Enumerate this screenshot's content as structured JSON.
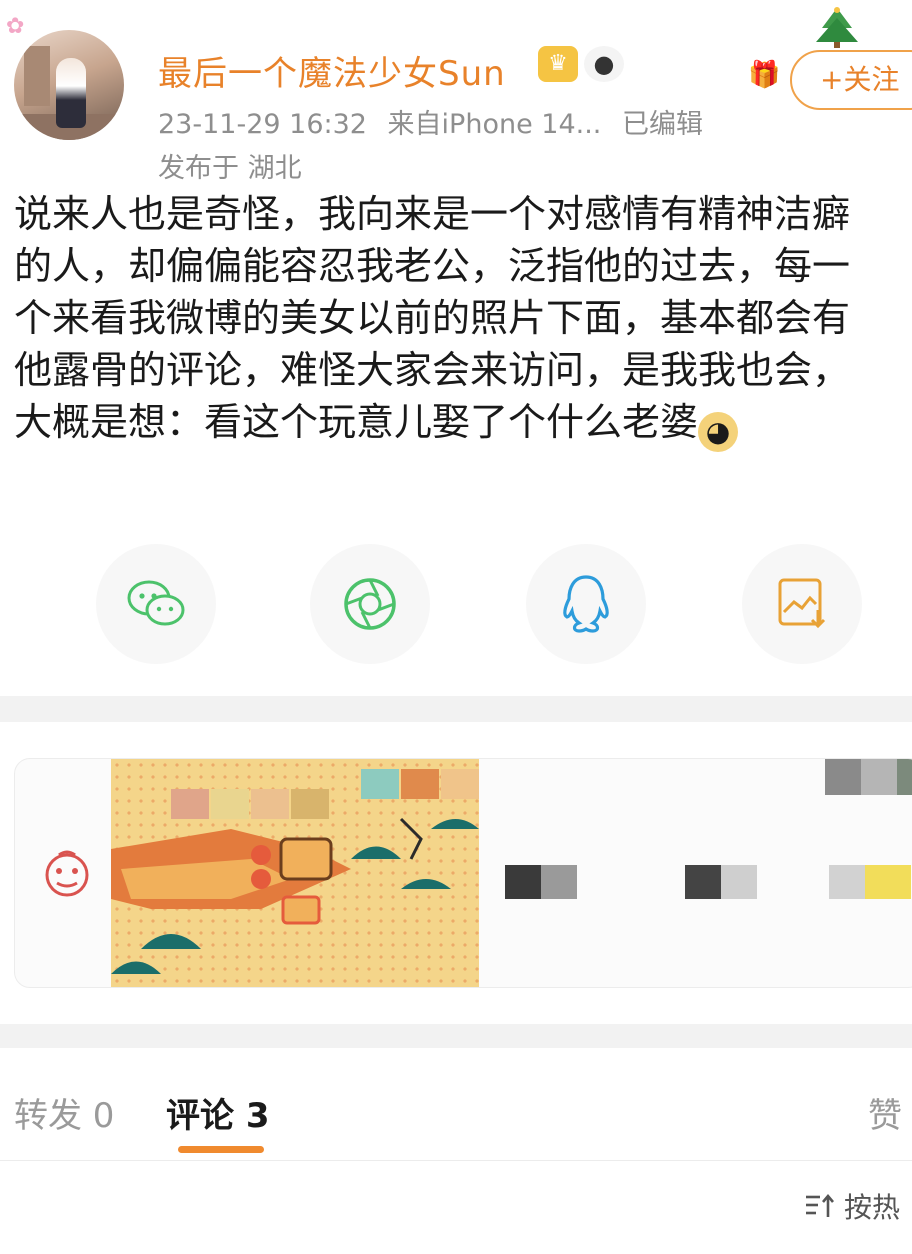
{
  "post": {
    "username": "最后一个魔法少女Sun",
    "timestamp": "23-11-29 16:32",
    "source": "来自iPhone 14...",
    "edited": "已编辑",
    "location": "发布于 湖北",
    "follow_label": "+关注",
    "text_lines": [
      "说来人也是奇怪，我向来是一个对感情有精神洁癖",
      "的人，却偏偏能容忍我老公，泛指他的过去，每一",
      "个来看我微博的美女以前的照片下面，基本都会有",
      "他露骨的评论，难怪大家会来访问，是我我也会，",
      "大概是想：看这个玩意儿娶了个什么老婆"
    ],
    "emoji": "doge-emoji"
  },
  "share": {
    "items": [
      {
        "icon": "wechat-icon",
        "color": "#4cc26b"
      },
      {
        "icon": "moments-icon",
        "color": "#4cc26b"
      },
      {
        "icon": "qq-icon",
        "color": "#2d9cdb"
      },
      {
        "icon": "save-image-icon",
        "color": "#e8a236"
      }
    ]
  },
  "tabs": {
    "repost": "转发 0",
    "comment": "评论 3",
    "like": "赞"
  },
  "sort": {
    "label": "按热"
  },
  "colors": {
    "accent": "#e8822a",
    "underline": "#f08a2e",
    "meta": "#8e8e8e"
  }
}
